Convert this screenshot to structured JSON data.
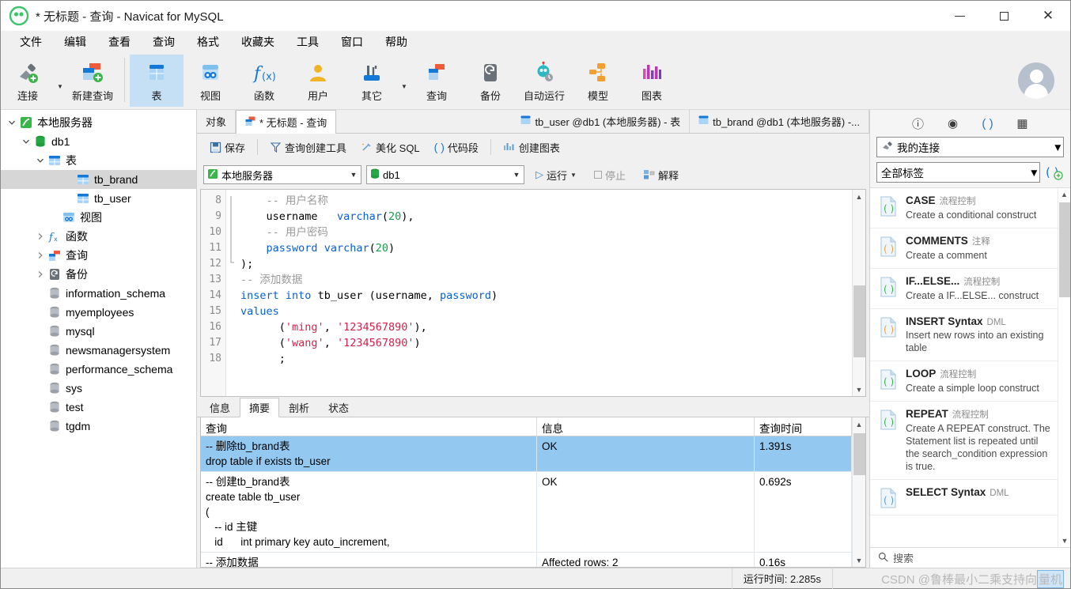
{
  "window": {
    "title": "* 无标题 - 查询 - Navicat for MySQL",
    "minimize_label": "",
    "maximize_label": "",
    "close_label": "✕"
  },
  "menubar": {
    "items": [
      {
        "label": "文件",
        "name": "menu-file"
      },
      {
        "label": "编辑",
        "name": "menu-edit"
      },
      {
        "label": "查看",
        "name": "menu-view"
      },
      {
        "label": "查询",
        "name": "menu-query"
      },
      {
        "label": "格式",
        "name": "menu-format"
      },
      {
        "label": "收藏夹",
        "name": "menu-favorites"
      },
      {
        "label": "工具",
        "name": "menu-tools"
      },
      {
        "label": "窗口",
        "name": "menu-window"
      },
      {
        "label": "帮助",
        "name": "menu-help"
      }
    ]
  },
  "ribbon": {
    "items": [
      {
        "label": "连接",
        "icon": "connection-icon",
        "active": false
      },
      {
        "label": "新建查询",
        "icon": "new-query-icon",
        "active": false
      },
      {
        "label": "表",
        "icon": "table-icon",
        "active": true
      },
      {
        "label": "视图",
        "icon": "view-icon",
        "active": false
      },
      {
        "label": "函数",
        "icon": "function-icon",
        "active": false
      },
      {
        "label": "用户",
        "icon": "user-icon",
        "active": false
      },
      {
        "label": "其它",
        "icon": "other-icon",
        "active": false
      },
      {
        "label": "查询",
        "icon": "query-icon",
        "active": false
      },
      {
        "label": "备份",
        "icon": "backup-icon",
        "active": false
      },
      {
        "label": "自动运行",
        "icon": "automation-icon",
        "active": false
      },
      {
        "label": "模型",
        "icon": "model-icon",
        "active": false
      },
      {
        "label": "图表",
        "icon": "chart-icon",
        "active": false
      }
    ]
  },
  "sidebar": {
    "items": [
      {
        "label": "本地服务器",
        "indent": 0,
        "twisty": "down",
        "icon": "server-icon",
        "selected": false
      },
      {
        "label": "db1",
        "indent": 1,
        "twisty": "down",
        "icon": "database-icon",
        "selected": false
      },
      {
        "label": "表",
        "indent": 2,
        "twisty": "down",
        "icon": "table-icon",
        "selected": false
      },
      {
        "label": "tb_brand",
        "indent": 4,
        "twisty": "none",
        "icon": "table-icon",
        "selected": true
      },
      {
        "label": "tb_user",
        "indent": 4,
        "twisty": "none",
        "icon": "table-icon",
        "selected": false
      },
      {
        "label": "视图",
        "indent": 3,
        "twisty": "none",
        "icon": "view-icon",
        "selected": false
      },
      {
        "label": "函数",
        "indent": 2,
        "twisty": "right",
        "icon": "function-icon",
        "selected": false
      },
      {
        "label": "查询",
        "indent": 2,
        "twisty": "right",
        "icon": "query-icon",
        "selected": false
      },
      {
        "label": "备份",
        "indent": 2,
        "twisty": "right",
        "icon": "backup-icon",
        "selected": false
      },
      {
        "label": "information_schema",
        "indent": 2,
        "twisty": "none",
        "icon": "db-gray-icon",
        "selected": false
      },
      {
        "label": "myemployees",
        "indent": 2,
        "twisty": "none",
        "icon": "db-gray-icon",
        "selected": false
      },
      {
        "label": "mysql",
        "indent": 2,
        "twisty": "none",
        "icon": "db-gray-icon",
        "selected": false
      },
      {
        "label": "newsmanagersystem",
        "indent": 2,
        "twisty": "none",
        "icon": "db-gray-icon",
        "selected": false
      },
      {
        "label": "performance_schema",
        "indent": 2,
        "twisty": "none",
        "icon": "db-gray-icon",
        "selected": false
      },
      {
        "label": "sys",
        "indent": 2,
        "twisty": "none",
        "icon": "db-gray-icon",
        "selected": false
      },
      {
        "label": "test",
        "indent": 2,
        "twisty": "none",
        "icon": "db-gray-icon",
        "selected": false
      },
      {
        "label": "tgdm",
        "indent": 2,
        "twisty": "none",
        "icon": "db-gray-icon",
        "selected": false
      }
    ]
  },
  "tabs": {
    "object_tab": "对象",
    "query_tab": "* 无标题 - 查询",
    "right_tabs": [
      "tb_user @db1 (本地服务器) - 表",
      "tb_brand @db1 (本地服务器) -..."
    ]
  },
  "query_toolbar": {
    "save": "保存",
    "query_builder": "查询创建工具",
    "beautify_sql": "美化 SQL",
    "code_snippet": "代码段",
    "create_chart": "创建图表"
  },
  "query_bar": {
    "connection": "本地服务器",
    "database": "db1",
    "run": "运行",
    "stop": "停止",
    "explain": "解释"
  },
  "editor": {
    "first_line_number": 8,
    "lines": [
      {
        "n": 8,
        "tokens": [
          {
            "t": "    ",
            "c": "pl"
          },
          {
            "t": "-- 用户名称",
            "c": "cm"
          }
        ]
      },
      {
        "n": 9,
        "tokens": [
          {
            "t": "    ",
            "c": "pl"
          },
          {
            "t": "username",
            "c": "pl"
          },
          {
            "t": "   ",
            "c": "pl"
          },
          {
            "t": "varchar",
            "c": "k"
          },
          {
            "t": "(",
            "c": "pl"
          },
          {
            "t": "20",
            "c": "num"
          },
          {
            "t": "),",
            "c": "pl"
          }
        ]
      },
      {
        "n": 10,
        "tokens": [
          {
            "t": "    ",
            "c": "pl"
          },
          {
            "t": "-- 用户密码",
            "c": "cm"
          }
        ]
      },
      {
        "n": 11,
        "tokens": [
          {
            "t": "    ",
            "c": "pl"
          },
          {
            "t": "password",
            "c": "k"
          },
          {
            "t": " ",
            "c": "pl"
          },
          {
            "t": "varchar",
            "c": "k"
          },
          {
            "t": "(",
            "c": "pl"
          },
          {
            "t": "20",
            "c": "num"
          },
          {
            "t": ")",
            "c": "pl"
          }
        ]
      },
      {
        "n": 12,
        "tokens": [
          {
            "t": ");",
            "c": "pl"
          }
        ]
      },
      {
        "n": 13,
        "tokens": [
          {
            "t": "-- 添加数据",
            "c": "cm"
          }
        ]
      },
      {
        "n": 14,
        "tokens": [
          {
            "t": "insert",
            "c": "k"
          },
          {
            "t": " ",
            "c": "pl"
          },
          {
            "t": "into",
            "c": "k"
          },
          {
            "t": " tb_user (username, ",
            "c": "pl"
          },
          {
            "t": "password",
            "c": "k"
          },
          {
            "t": ")",
            "c": "pl"
          }
        ]
      },
      {
        "n": 15,
        "tokens": [
          {
            "t": "values",
            "c": "k"
          }
        ]
      },
      {
        "n": 16,
        "tokens": [
          {
            "t": "      (",
            "c": "pl"
          },
          {
            "t": "'ming'",
            "c": "str"
          },
          {
            "t": ", ",
            "c": "pl"
          },
          {
            "t": "'1234567890'",
            "c": "str"
          },
          {
            "t": "),",
            "c": "pl"
          }
        ]
      },
      {
        "n": 17,
        "tokens": [
          {
            "t": "      (",
            "c": "pl"
          },
          {
            "t": "'wang'",
            "c": "str"
          },
          {
            "t": ", ",
            "c": "pl"
          },
          {
            "t": "'1234567890'",
            "c": "str"
          },
          {
            "t": ")",
            "c": "pl"
          }
        ]
      },
      {
        "n": 18,
        "tokens": [
          {
            "t": "      ;",
            "c": "pl"
          }
        ]
      }
    ]
  },
  "results": {
    "tabs": [
      {
        "label": "信息",
        "active": false
      },
      {
        "label": "摘要",
        "active": true
      },
      {
        "label": "剖析",
        "active": false
      },
      {
        "label": "状态",
        "active": false
      }
    ],
    "columns": [
      "查询",
      "信息",
      "查询时间"
    ],
    "rows": [
      {
        "query": "-- 删除tb_brand表\ndrop table if exists tb_user",
        "message": "OK",
        "time": "1.391s",
        "selected": true
      },
      {
        "query": "-- 创建tb_brand表\ncreate table tb_user\n(\n   -- id 主键\n   id      int primary key auto_increment,",
        "message": "OK",
        "time": "0.692s",
        "selected": false
      },
      {
        "query": "-- 添加数据",
        "message": "Affected rows: 2",
        "time": "0.16s",
        "selected": false
      }
    ]
  },
  "right_panel": {
    "icons": [
      {
        "name": "info-icon",
        "glyph": "ⓘ",
        "active": false
      },
      {
        "name": "eye-icon",
        "glyph": "◉",
        "active": false
      },
      {
        "name": "code-snippet-icon",
        "glyph": "( )",
        "active": true
      },
      {
        "name": "grid-icon",
        "glyph": "▦",
        "active": false
      }
    ],
    "connection_select": "我的连接",
    "tag_select": "全部标签",
    "add_snippet_label": "",
    "snippets": [
      {
        "title": "CASE",
        "category": "流程控制",
        "desc": "Create a conditional construct",
        "icon_color": "green"
      },
      {
        "title": "COMMENTS",
        "category": "注释",
        "desc": "Create a comment",
        "icon_color": "orange"
      },
      {
        "title": "IF...ELSE...",
        "category": "流程控制",
        "desc": "Create a IF...ELSE... construct",
        "icon_color": "green"
      },
      {
        "title": "INSERT Syntax",
        "category": "DML",
        "desc": "Insert new rows into an existing table",
        "icon_color": "orange"
      },
      {
        "title": "LOOP",
        "category": "流程控制",
        "desc": "Create a simple loop construct",
        "icon_color": "green"
      },
      {
        "title": "REPEAT",
        "category": "流程控制",
        "desc": "Create A REPEAT construct. The Statement list is repeated until the search_condition expression is true.",
        "icon_color": "green"
      },
      {
        "title": "SELECT Syntax",
        "category": "DML",
        "desc": "",
        "icon_color": "blue"
      }
    ],
    "search_placeholder": "搜索"
  },
  "statusbar": {
    "runtime": "运行时间: 2.285s",
    "watermark_prefix": "CSDN @鲁棒最小二乘支持向",
    "watermark_boxed": "量机"
  },
  "colors": {
    "accent": "#1479d6",
    "selection": "#93c9f0",
    "ribbon_active": "#c5e0f5",
    "tree_selected": "#d6d6d6"
  }
}
